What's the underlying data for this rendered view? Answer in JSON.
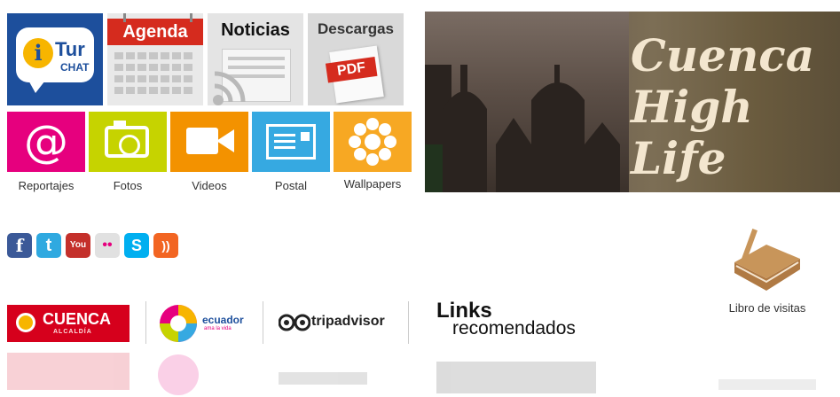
{
  "tiles": {
    "itur": {
      "main": "Tur",
      "sub": "CHAT",
      "letter": "i"
    },
    "agenda": {
      "label": "Agenda"
    },
    "noticias": {
      "label": "Noticias"
    },
    "descargas": {
      "label": "Descargas",
      "badge": "PDF"
    }
  },
  "media": [
    {
      "label": "Reportajes",
      "color": "#e6007e",
      "icon": "at-icon"
    },
    {
      "label": "Fotos",
      "color": "#c6d300",
      "icon": "camera-icon"
    },
    {
      "label": "Videos",
      "color": "#f39200",
      "icon": "video-camera-icon"
    },
    {
      "label": "Postal",
      "color": "#36a9e1",
      "icon": "postcard-icon"
    },
    {
      "label": "Wallpapers",
      "color": "#f7a823",
      "icon": "flower-icon"
    }
  ],
  "hero": {
    "line1": "Cuenca",
    "line2": "High",
    "line3": "Life"
  },
  "social": [
    {
      "name": "facebook",
      "glyph": "f",
      "color": "#3b5998"
    },
    {
      "name": "twitter",
      "glyph": "t",
      "color": "#2fa9e0"
    },
    {
      "name": "youtube",
      "glyph": "You",
      "color": "#c4302b"
    },
    {
      "name": "flickr",
      "glyph": "••",
      "color": "#e1e1e1"
    },
    {
      "name": "skype",
      "glyph": "S",
      "color": "#00aff0"
    },
    {
      "name": "rss",
      "glyph": "))",
      "color": "#f26522"
    }
  ],
  "guestbook": {
    "label": "Libro de visitas"
  },
  "links": {
    "cuenca": {
      "main": "CUENCA",
      "sub": "ALCALDÍA"
    },
    "ecuador": {
      "main": "ecuador",
      "sub": "ama la vida"
    },
    "tripadvisor": {
      "main": "tripadvisor"
    },
    "recommended": {
      "line1": "Links",
      "line2": "recomendados"
    }
  },
  "colors": {
    "itur_bg": "#1d4f9c",
    "agenda_red": "#d52b1e",
    "cuenca_red": "#d6001c",
    "hero_text": "#f3e6cf",
    "book": "#c8955a"
  }
}
